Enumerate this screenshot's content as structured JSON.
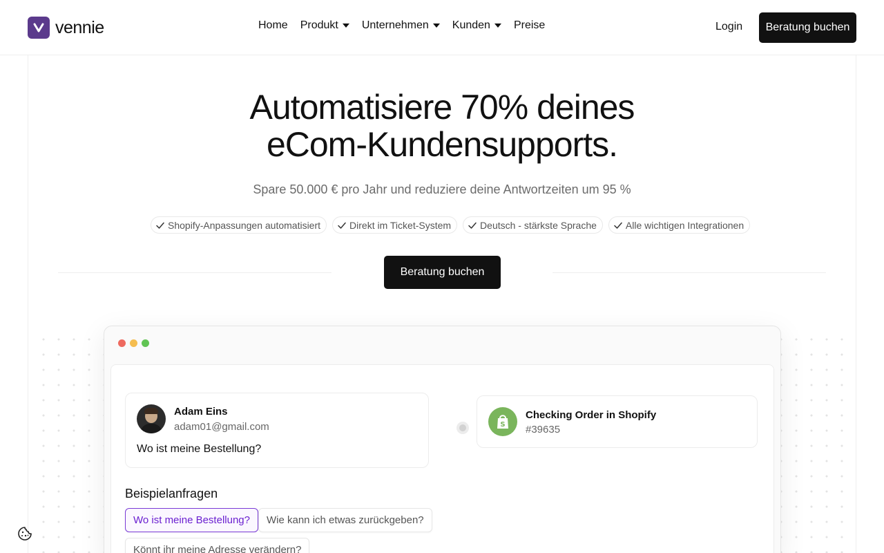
{
  "header": {
    "logo_text": "vennie",
    "nav": [
      {
        "label": "Home",
        "dropdown": false
      },
      {
        "label": "Produkt",
        "dropdown": true
      },
      {
        "label": "Unternehmen",
        "dropdown": true
      },
      {
        "label": "Kunden",
        "dropdown": true
      },
      {
        "label": "Preise",
        "dropdown": false
      }
    ],
    "login_label": "Login",
    "cta_label": "Beratung buchen"
  },
  "hero": {
    "title_line1": "Automatisiere 70% deines",
    "title_line2": "eCom-Kundensupports.",
    "subtitle": "Spare 50.000 € pro Jahr und reduziere deine Antwortzeiten um 95 %",
    "features": [
      "Shopify-Anpassungen automatisiert",
      "Direkt im Ticket-System",
      "Deutsch - stärkste Sprache",
      "Alle wichtigen Integrationen"
    ],
    "cta_label": "Beratung buchen"
  },
  "demo": {
    "window_controls": [
      "#ee6a5f",
      "#f5bd4f",
      "#61c454"
    ],
    "message": {
      "name": "Adam Eins",
      "email": "adam01@gmail.com",
      "text": "Wo ist meine Bestellung?"
    },
    "shopify": {
      "title": "Checking Order in Shopify",
      "order": "#39635"
    },
    "examples_title": "Beispielanfragen",
    "examples": [
      "Wo ist meine Bestellung?",
      "Wie kann ich etwas zurückgeben?",
      "Könnt ihr meine Adresse verändern?"
    ],
    "active_example_index": 0
  },
  "colors": {
    "brand": "#5b3a8c",
    "cta": "#111111",
    "active_example": "#7a3bd6",
    "shopify": "#7ab55c"
  }
}
